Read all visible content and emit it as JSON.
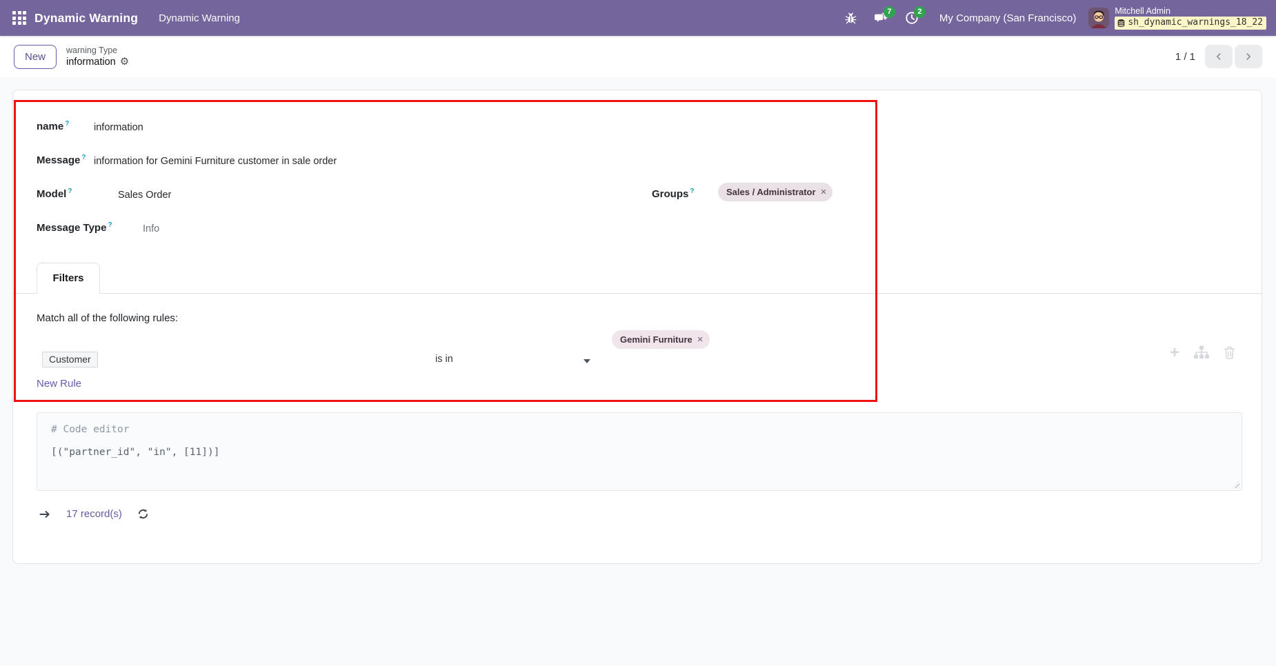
{
  "navbar": {
    "app_title": "Dynamic Warning",
    "menu_item": "Dynamic Warning",
    "message_badge": "7",
    "activity_badge": "2",
    "company": "My Company (San Francisco)",
    "user_name": "Mitchell Admin",
    "database": "sh_dynamic_warnings_18_22"
  },
  "control_panel": {
    "new_button": "New",
    "breadcrumb_parent": "warning Type",
    "breadcrumb_current": "information",
    "pager": "1 / 1"
  },
  "form": {
    "help_indicator": "?",
    "fields": {
      "name": {
        "label": "name",
        "value": "information"
      },
      "message": {
        "label": "Message",
        "value": "information for Gemini Furniture customer in sale order"
      },
      "model": {
        "label": "Model",
        "value": "Sales Order"
      },
      "groups": {
        "label": "Groups",
        "tag": "Sales / Administrator"
      },
      "message_type": {
        "label": "Message Type",
        "value": "Info"
      }
    }
  },
  "notebook": {
    "filters_tab": "Filters"
  },
  "filters": {
    "match_text": "Match all of the following rules:",
    "rule_field": "Customer",
    "rule_operator": "is in",
    "value_tag": "Gemini Furniture",
    "new_rule": "New Rule"
  },
  "code_editor": {
    "comment": "# Code editor",
    "code": "[(\"partner_id\", \"in\", [11])]"
  },
  "records": {
    "count": "17 record(s)"
  },
  "icons": {
    "gear": "⚙",
    "remove": "×",
    "plus": "+"
  },
  "colors": {
    "navbar": "#74659c",
    "badge_green": "#2fa44e",
    "annotation_red": "#ee1111",
    "link_purple": "#675ba7",
    "db_badge_yellow": "#fbf5c8"
  }
}
